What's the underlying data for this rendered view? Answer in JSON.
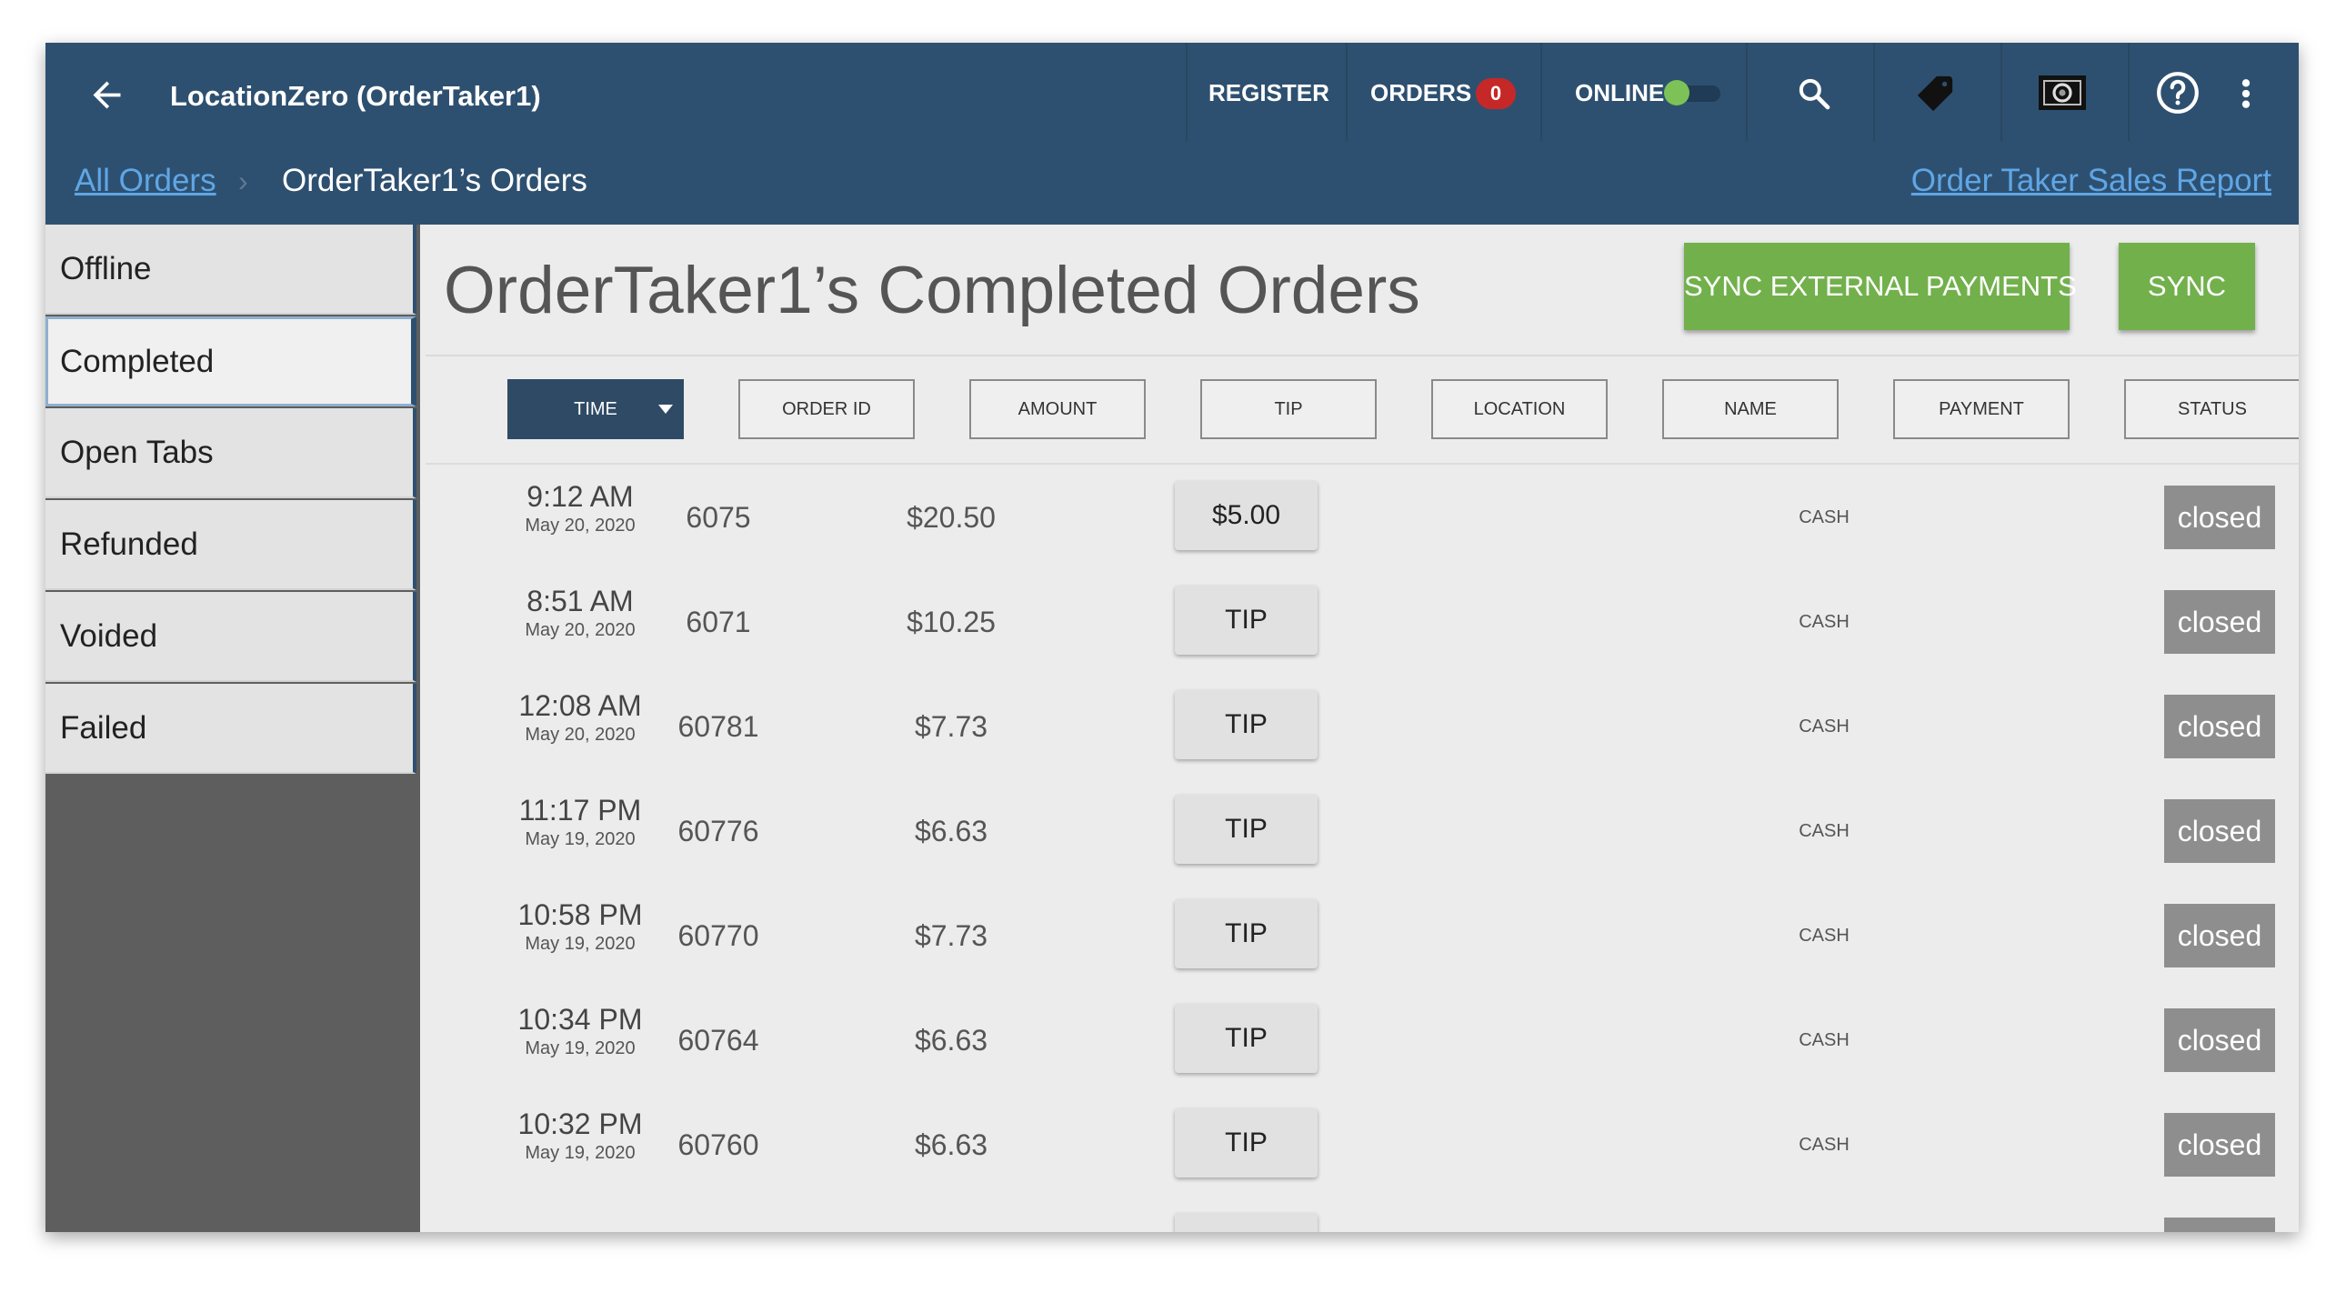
{
  "header": {
    "title": "LocationZero (OrderTaker1)",
    "register_label": "REGISTER",
    "orders_label": "ORDERS",
    "orders_count": "0",
    "online_label": "ONLINE"
  },
  "breadcrumb": {
    "root": "All Orders",
    "current": "OrderTaker1’s Orders",
    "report_link": "Order Taker Sales Report"
  },
  "sidebar": {
    "items": [
      {
        "label": "Offline"
      },
      {
        "label": "Completed"
      },
      {
        "label": "Open Tabs"
      },
      {
        "label": "Refunded"
      },
      {
        "label": "Voided"
      },
      {
        "label": "Failed"
      }
    ]
  },
  "main": {
    "title": "OrderTaker1’s Completed Orders",
    "sync_external_label": "SYNC EXTERNAL PAYMENTS",
    "sync_label": "SYNC",
    "columns": [
      "TIME",
      "ORDER ID",
      "AMOUNT",
      "TIP",
      "LOCATION",
      "NAME",
      "PAYMENT",
      "STATUS"
    ],
    "rows": [
      {
        "time": "9:12 AM",
        "date": "May 20, 2020",
        "order_id": "6075",
        "amount": "$20.50",
        "tip": "$5.00",
        "payment": "CASH",
        "status": "closed"
      },
      {
        "time": "8:51 AM",
        "date": "May 20, 2020",
        "order_id": "6071",
        "amount": "$10.25",
        "tip": "TIP",
        "payment": "CASH",
        "status": "closed"
      },
      {
        "time": "12:08 AM",
        "date": "May 20, 2020",
        "order_id": "60781",
        "amount": "$7.73",
        "tip": "TIP",
        "payment": "CASH",
        "status": "closed"
      },
      {
        "time": "11:17 PM",
        "date": "May 19, 2020",
        "order_id": "60776",
        "amount": "$6.63",
        "tip": "TIP",
        "payment": "CASH",
        "status": "closed"
      },
      {
        "time": "10:58 PM",
        "date": "May 19, 2020",
        "order_id": "60770",
        "amount": "$7.73",
        "tip": "TIP",
        "payment": "CASH",
        "status": "closed"
      },
      {
        "time": "10:34 PM",
        "date": "May 19, 2020",
        "order_id": "60764",
        "amount": "$6.63",
        "tip": "TIP",
        "payment": "CASH",
        "status": "closed"
      },
      {
        "time": "10:32 PM",
        "date": "May 19, 2020",
        "order_id": "60760",
        "amount": "$6.63",
        "tip": "TIP",
        "payment": "CASH",
        "status": "closed"
      }
    ]
  },
  "colors": {
    "header_bg": "#2e5070",
    "accent_green": "#72b04c",
    "badge_red": "#c62828",
    "link_blue": "#5fa6e6",
    "status_gray": "#8e8e8e"
  },
  "icons": [
    "back-arrow-icon",
    "search-icon",
    "tag-icon",
    "camera-icon",
    "help-icon",
    "more-vert-icon",
    "sort-caret-icon"
  ]
}
